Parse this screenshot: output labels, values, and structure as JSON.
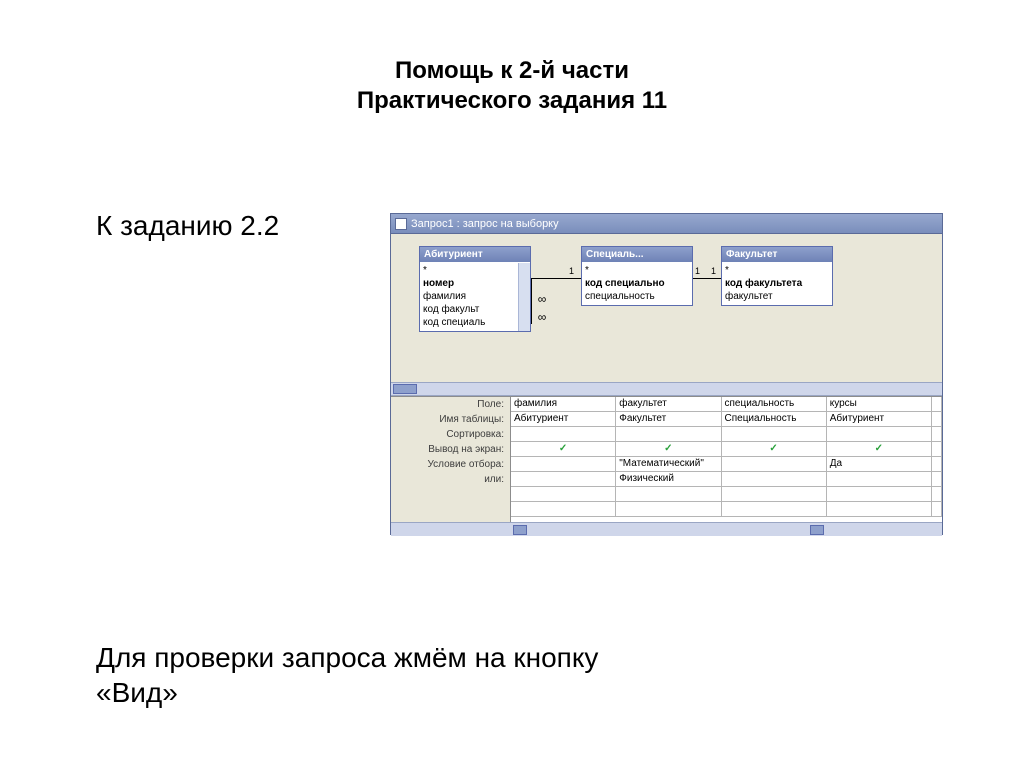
{
  "title": {
    "line1": "Помощь к 2-й части",
    "line2": "Практического задания 11"
  },
  "lead": "К заданию 2.2",
  "bottom": {
    "line1": "Для проверки запроса жмём на кнопку",
    "line2": "«Вид»"
  },
  "query_window": {
    "title": "Запрос1 : запрос на выборку",
    "entities": {
      "e1": {
        "name": "Абитуриент",
        "fields": [
          "*",
          "номер",
          "фамилия",
          "код факульт",
          "код специаль"
        ]
      },
      "e2": {
        "name": "Специаль...",
        "fields": [
          "*",
          "код специально",
          "специальность"
        ]
      },
      "e3": {
        "name": "Факультет",
        "fields": [
          "*",
          "код факультета",
          "факультет"
        ]
      }
    },
    "labels": {
      "field": "Поле:",
      "table": "Имя таблицы:",
      "sort": "Сортировка:",
      "show": "Вывод на экран:",
      "criteria": "Условие отбора:",
      "or": "или:"
    },
    "grid": {
      "field": [
        "фамилия",
        "факультет",
        "специальность",
        "курсы"
      ],
      "table": [
        "Абитуриент",
        "Факультет",
        "Специальность",
        "Абитуриент"
      ],
      "sort": [
        "",
        "",
        "",
        ""
      ],
      "show": [
        "✓",
        "✓",
        "✓",
        "✓"
      ],
      "criteria": [
        "",
        "\"Математический\"",
        "",
        "Да"
      ],
      "or": [
        "",
        "Физический",
        "",
        ""
      ]
    },
    "rel": {
      "one": "1",
      "many": "∞"
    }
  }
}
